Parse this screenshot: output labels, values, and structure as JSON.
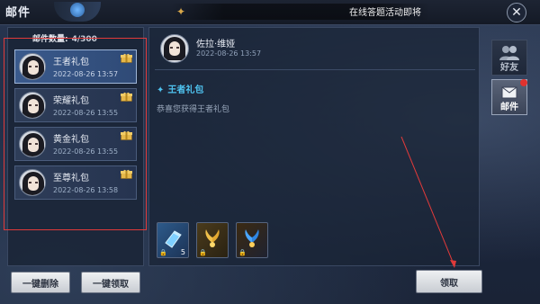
{
  "window": {
    "title": "邮件",
    "close_label": "✕"
  },
  "marquee": {
    "text": "在线答题活动即将"
  },
  "mail_list": {
    "count_label": "邮件数量:",
    "count_value": "4/300",
    "items": [
      {
        "name": "王者礼包",
        "time": "2022-08-26 13:57",
        "active": true
      },
      {
        "name": "荣耀礼包",
        "time": "2022-08-26 13:55",
        "active": false
      },
      {
        "name": "黄金礼包",
        "time": "2022-08-26 13:55",
        "active": false
      },
      {
        "name": "至尊礼包",
        "time": "2022-08-26 13:58",
        "active": false
      }
    ]
  },
  "buttons": {
    "delete_all": "一键删除",
    "claim_all": "一键领取",
    "claim": "领取"
  },
  "detail": {
    "sender": "佐拉·维娅",
    "time": "2022-08-26 13:57",
    "subject": "王者礼包",
    "body": "恭喜您获得王者礼包"
  },
  "attachments": [
    {
      "icon": "blue-crystal-icon",
      "qty": "5"
    },
    {
      "icon": "golden-wings-icon",
      "qty": ""
    },
    {
      "icon": "blue-wings-icon",
      "qty": ""
    }
  ],
  "side_tabs": [
    {
      "label": "好友",
      "icon": "friends-icon",
      "active": false
    },
    {
      "label": "邮件",
      "icon": "mail-icon",
      "active": true,
      "badge": true
    }
  ],
  "colors": {
    "accent_blue": "#4fc3f0",
    "highlight_red": "#e03a3a",
    "gift_gold": "#e6b84a"
  }
}
